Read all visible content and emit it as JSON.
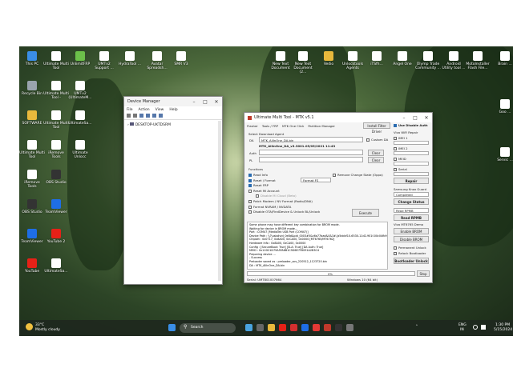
{
  "desktop_icons": [
    {
      "label": "This PC",
      "color": "#3a8ee6"
    },
    {
      "label": "Recycle Bin",
      "color": "#9aa4ae"
    },
    {
      "label": "SOFTWARE",
      "color": "#e8b93c"
    },
    {
      "label": "Ultimate Multi Tool",
      "color": "#ffffff"
    },
    {
      "label": "iRemove Tools",
      "color": "#ffffff"
    },
    {
      "label": "OBS Studio",
      "color": "#333333"
    },
    {
      "label": "TeamViewer",
      "color": "#1e6ee6"
    },
    {
      "label": "YouTube",
      "color": "#e62117"
    },
    {
      "label": "Ultimate Multi Tool",
      "color": "#ffffff"
    },
    {
      "label": "Ultimate Multi Tool -",
      "color": "#ffffff"
    },
    {
      "label": "Ultimate Multi Tool",
      "color": "#ffffff"
    },
    {
      "label": "iRemove Tools",
      "color": "#ffffff"
    },
    {
      "label": "OBS Studio",
      "color": "#333333"
    },
    {
      "label": "TeamViewer",
      "color": "#1e6ee6"
    },
    {
      "label": "YouTube 2",
      "color": "#e62117"
    },
    {
      "label": "UltimateSa...",
      "color": "#ffffff"
    },
    {
      "label": "UnlimitFRP",
      "color": "#6cc04a"
    },
    {
      "label": "UMTv2 (UltimateM...",
      "color": "#ffffff"
    },
    {
      "label": "UltimateSa...",
      "color": "#ffffff"
    },
    {
      "label": "Ultimate Unlocc",
      "color": "#ffffff"
    },
    {
      "label": "UMTv2 Support ...",
      "color": "#ffffff"
    },
    {
      "label": "HydraTool ...",
      "color": "#ffffff"
    },
    {
      "label": "Avatar Spreadsh...",
      "color": "#ffffff"
    },
    {
      "label": "SMR V3",
      "color": "#ffffff"
    },
    {
      "label": "New Text Document",
      "color": "#ffffff"
    },
    {
      "label": "New Text Document (2...",
      "color": "#ffffff"
    },
    {
      "label": "Vedio",
      "color": "#e8b93c"
    },
    {
      "label": "Unlocktools Agents",
      "color": "#ffffff"
    },
    {
      "label": "iTSfh...",
      "color": "#ffffff"
    },
    {
      "label": "Angel One",
      "color": "#ffffff"
    },
    {
      "label": "Olymp Trade Community ...",
      "color": "#ffffff"
    },
    {
      "label": "Android Utility tool ...",
      "color": "#ffffff"
    },
    {
      "label": "MotoInstaller Flash File...",
      "color": "#ffffff"
    },
    {
      "label": "Brain ...",
      "color": "#ffffff"
    },
    {
      "label": "Goo ...",
      "color": "#ffffff"
    },
    {
      "label": "Servic ...",
      "color": "#ffffff"
    }
  ],
  "device_manager": {
    "title": "Device Manager",
    "menu": [
      "File",
      "Action",
      "View",
      "Help"
    ],
    "tree_root": "DESKTOP-UKTDSRM"
  },
  "umt": {
    "title": "Ultimate Multi Tool - MTK v5.1",
    "tabs": [
      "Flasher",
      "Tools / FRP",
      "MTK One Click",
      "Partition Manager"
    ],
    "install_driver": "Install Filter Driver",
    "use_disable_auth": "Use Disable Auth",
    "select_download_agent": "Select Download Agent",
    "da_label": "DA",
    "da_value": "MTK_AllInOne_DA.bin",
    "da_info": "MTK_AllInOne_DA_v3.3001.05/05/2021 11:43",
    "custom_da": "Custom DA",
    "auth_label": "Auth",
    "pl_label": "PL",
    "clear": "Clear",
    "functions": "Functions",
    "func_items": [
      {
        "label": "Read Info",
        "on": true
      },
      {
        "label": "Reset / Format",
        "on": true
      },
      {
        "label": "Reset FRP",
        "on": true
      },
      {
        "label": "Reset Mi Account",
        "on": false
      },
      {
        "label": "Disable Mi Cloud (Beta)",
        "on": false
      },
      {
        "label": "Patch Modem / NV Format (Radio/DNA)",
        "on": false
      },
      {
        "label": "Format NVRAM / NVDATA",
        "on": false
      },
      {
        "label": "Disable OTA/FindDevice & Unlock BL/Unlock",
        "on": false
      }
    ],
    "format_option": "Format FS",
    "remove_change_state": "Remove Change State (Oppo)",
    "execute": "Execute",
    "right_panel": {
      "wifi_repair": "Vivo WiFi Repair",
      "imei1": "IMEI 1",
      "imei2": "IMEI 2",
      "mac": "MEID",
      "serial": "Serial",
      "repair": "Repair",
      "samsung_knox": "Samsung Knox Guard",
      "completed": "Completed",
      "change_status": "Change Status",
      "read_rpmb_sel": "Read RPMB",
      "read_rpmb": "Read RPMB",
      "vivo_demo": "Vivo MT6765 Demo",
      "enable_brom": "Enable BROM",
      "disable_brom": "Disable BROM",
      "permanent_unlock": "Permanent Unlock",
      "relock_bootloader": "Relock Bootloader",
      "bootloader_unlock": "Bootloader Unlock"
    },
    "log": [
      "Some phone may have different key combination for BROM mode.",
      "Waiting for device in BROM mode...",
      "Port : COM47 [MediaTek USB Port (COM47)]",
      "Device Path : \\\\?\\usb#vid_0e8d&pid_0003#5&c6a77bad&0&3#{a5dcbf10-6530-11d2-901f-00c04fb951ed}",
      "Chipset : 0x0717, 0x8A00, 0xCA00, 0x0000 [MT6765/MT6762]",
      "Hardware Info : 0x8A00, 0xCA00, 0x0000",
      "Config : [SecureBoot: True] [SLA: True] [DA Auth: True]",
      "MEID : 0x11D21D79A5FA6B1C5D6E7F8091A2B3C4",
      "Preparing device ...",
      "- Success",
      "Preloader saved as : preloader_ocs_220512_1123720.bin",
      "DA : MTK_AllInOne_DA.bin"
    ],
    "progress_pct": "0%",
    "stop": "Stop",
    "serial": "Serial: UMT801007664",
    "os": "Windows 10 (64 bit)"
  },
  "taskbar": {
    "weather_temp": "33°C",
    "weather_desc": "Mostly cloudy",
    "search_label": "Search",
    "lang": "ENG",
    "lang2": "IN",
    "time": "1:30 PM",
    "date": "5/15/2024"
  }
}
